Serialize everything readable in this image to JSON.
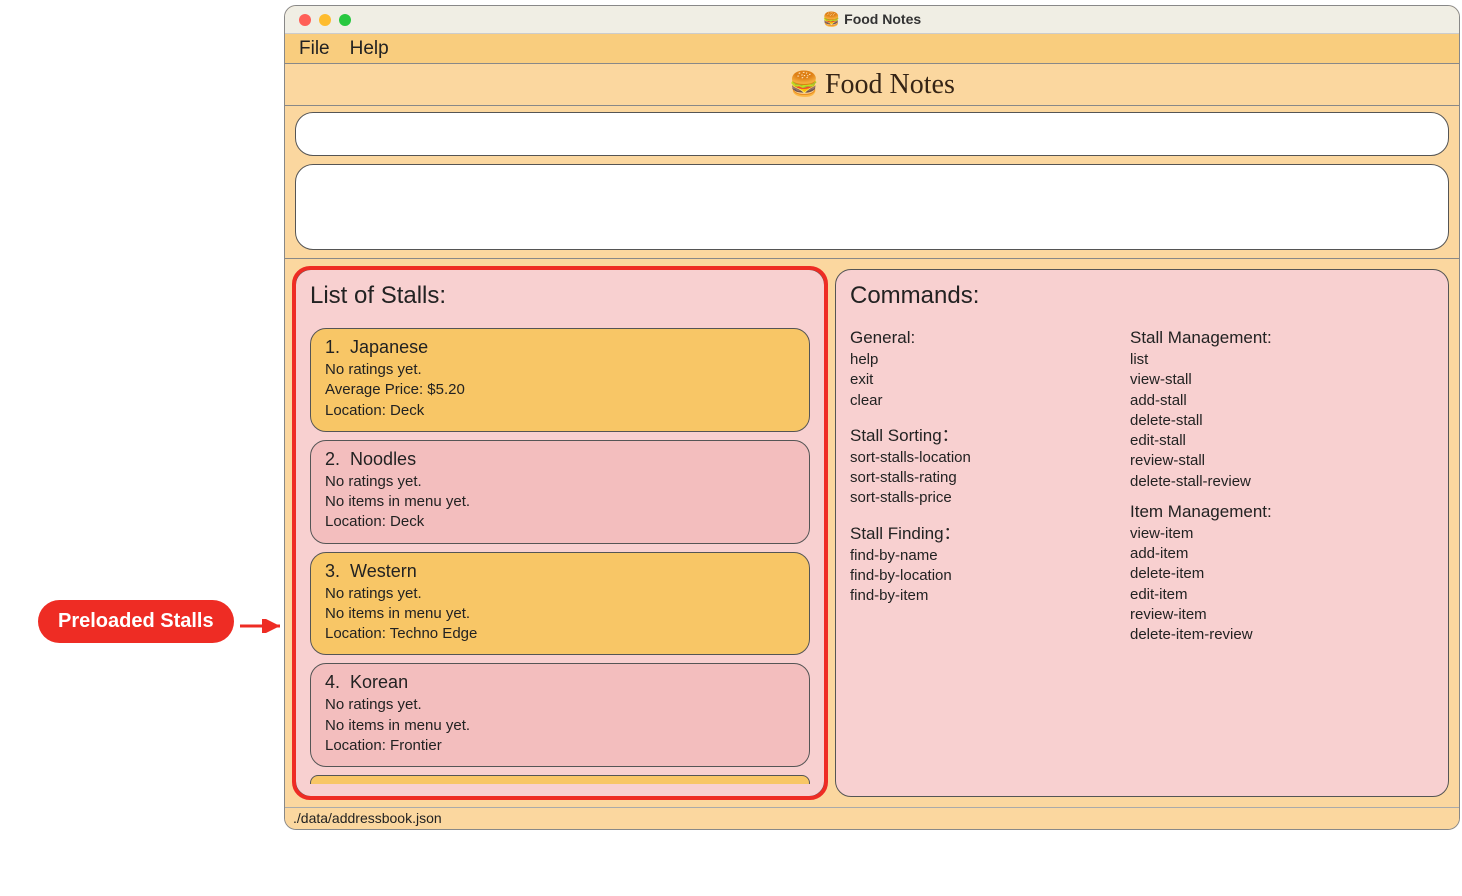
{
  "annotation": {
    "label": "Preloaded Stalls"
  },
  "titlebar": {
    "title": "Food Notes",
    "icon": "🍔"
  },
  "menubar": {
    "file": "File",
    "help": "Help"
  },
  "logo": {
    "text": "Food Notes",
    "icon": "🍔"
  },
  "command_input": {
    "value": ""
  },
  "output": {
    "value": ""
  },
  "panels": {
    "stalls_title": "List of Stalls:",
    "commands_title": "Commands:"
  },
  "stalls": [
    {
      "index": "1.",
      "name": "Japanese",
      "ratings": "No ratings yet.",
      "price": "Average Price: $5.20",
      "location": "Location: Deck",
      "variant": "orange"
    },
    {
      "index": "2.",
      "name": "Noodles",
      "ratings": "No ratings yet.",
      "price": "No items in menu yet.",
      "location": "Location: Deck",
      "variant": "pink"
    },
    {
      "index": "3.",
      "name": "Western",
      "ratings": "No ratings yet.",
      "price": "No items in menu yet.",
      "location": "Location: Techno Edge",
      "variant": "orange"
    },
    {
      "index": "4.",
      "name": "Korean",
      "ratings": "No ratings yet.",
      "price": "No items in menu yet.",
      "location": "Location: Frontier",
      "variant": "pink"
    }
  ],
  "commands": {
    "col1": [
      {
        "title": "General:",
        "items": [
          "help",
          "exit",
          "clear"
        ]
      },
      {
        "title": "Stall Sorting：",
        "items": [
          "sort-stalls-location",
          "sort-stalls-rating",
          "sort-stalls-price"
        ]
      },
      {
        "title": "Stall Finding：",
        "items": [
          "find-by-name",
          "find-by-location",
          "find-by-item"
        ]
      }
    ],
    "col2": [
      {
        "title": "Stall Management:",
        "items": [
          "list",
          "view-stall",
          "add-stall",
          "delete-stall",
          "edit-stall",
          "review-stall",
          "delete-stall-review"
        ]
      },
      {
        "title": "Item Management:",
        "items": [
          "view-item",
          "add-item",
          "delete-item",
          "edit-item",
          "review-item",
          "delete-item-review"
        ]
      }
    ]
  },
  "statusbar": {
    "path": "./data/addressbook.json"
  }
}
